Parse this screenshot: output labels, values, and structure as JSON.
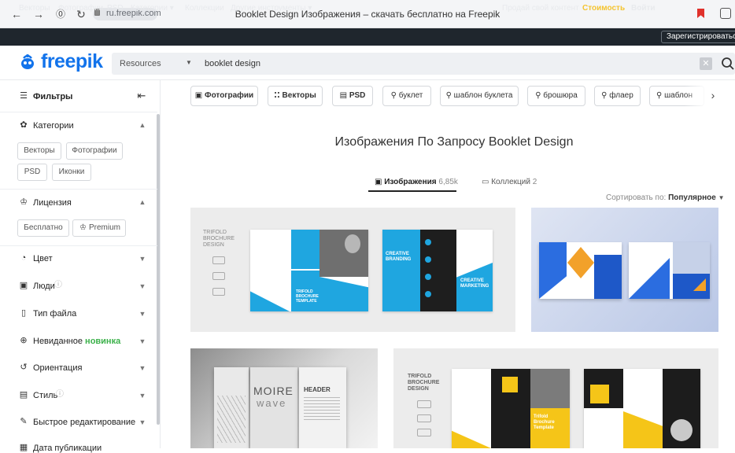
{
  "browser": {
    "url": "ru.freepik.com",
    "tab_title": "Booklet Design Изображения – скачать бесплатно на Freepik"
  },
  "topnav": {
    "left": [
      "Векторы",
      "Фотографии",
      "PSD",
      "Категории ▾",
      "Коллекции",
      "Другие инструменты ▾"
    ],
    "sell": "Продай свой контент",
    "price": "Стоимость",
    "login": "Войти",
    "register": "Зарегистрироваться"
  },
  "header": {
    "logo": "freepik",
    "resources": "Resources",
    "search_value": "booklet design"
  },
  "sidebar": {
    "filters_label": "Фильтры",
    "categories": {
      "title": "Категории",
      "chips": [
        "Векторы",
        "Фотографии",
        "PSD",
        "Иконки"
      ]
    },
    "license": {
      "title": "Лицензия",
      "chips": [
        "Бесплатно",
        "Premium"
      ]
    },
    "sections": [
      {
        "label": "Цвет"
      },
      {
        "label": "Люди"
      },
      {
        "label": "Тип файла"
      },
      {
        "label": "Невиданное",
        "badge": "новинка"
      },
      {
        "label": "Ориентация"
      },
      {
        "label": "Стиль"
      },
      {
        "label": "Быстрое редактирование"
      },
      {
        "label": "Дата публикации"
      }
    ]
  },
  "filter_chips": [
    "Фотографии",
    "Векторы",
    "PSD",
    "буклет",
    "шаблон буклета",
    "брошюра",
    "флаер",
    "шаблон"
  ],
  "main": {
    "title": "Изображения По Запросу Booklet Design",
    "tab_images": "Изображения",
    "tab_images_count": "6,85k",
    "tab_collections": "Коллекций",
    "tab_collections_count": "2",
    "sort_label": "Сортировать по:",
    "sort_value": "Популярное"
  },
  "cards": {
    "c1": {
      "label": "TRIFOLD BROCHURE DESIGN",
      "creative": "CREATIVE BRANDING",
      "marketing": "CREATIVE MARKETING",
      "trifold": "TRIFOLD BROCHURE TEMPLATE"
    },
    "c3": {
      "moire": "MOIRE",
      "wave": "wave",
      "header": "HEADER"
    },
    "c4": {
      "label": "TRIFOLD BROCHURE DESIGN",
      "tpl": "Trifold Brochure Template"
    }
  },
  "colors": {
    "brand": "#1273eb",
    "dark_nav": "#1f262d",
    "price": "#f4c430",
    "new_badge": "#3bb14a",
    "cyan": "#1fa6e0",
    "yellow": "#f5c518"
  }
}
